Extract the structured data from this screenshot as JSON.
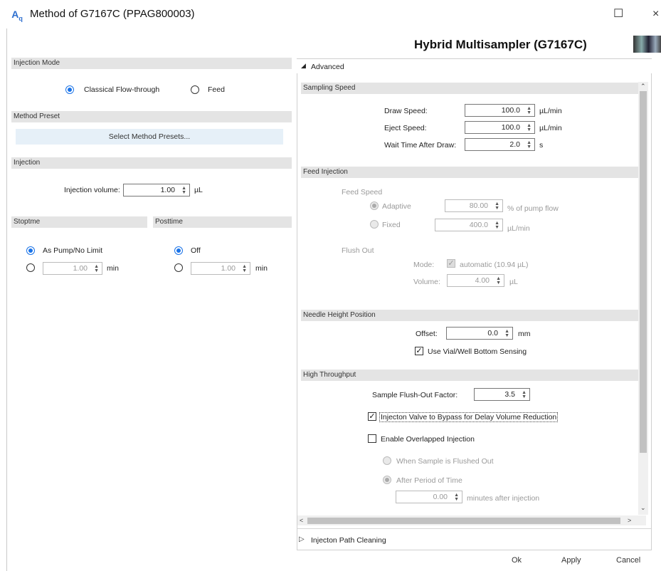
{
  "window": {
    "title": "Method of G7167C (PPAG800003)",
    "icon": "agilent-method-icon",
    "maximize_glyph": "☐",
    "close_glyph": "×",
    "device_title": "Hybrid Multisampler (G7167C)"
  },
  "left": {
    "injection_mode": {
      "header": "Injection Mode",
      "options": [
        "Classical Flow-through",
        "Feed"
      ],
      "selected": "Classical Flow-through"
    },
    "method_preset": {
      "header": "Method Preset",
      "button": "Select Method Presets..."
    },
    "injection": {
      "header": "Injection",
      "volume_label": "Injection volume:",
      "volume_value": "1.00",
      "volume_unit": "µL"
    },
    "stoptime": {
      "header": "Stoptme",
      "option_limit": "As Pump/No Limit",
      "value": "1.00",
      "unit": "min"
    },
    "posttime": {
      "header": "Posttime",
      "option_off": "Off",
      "value": "1.00",
      "unit": "min"
    }
  },
  "advanced": {
    "header": "Advanced",
    "sampling_speed": {
      "header": "Sampling Speed",
      "draw_label": "Draw Speed:",
      "draw_value": "100.0",
      "draw_unit": "µL/min",
      "eject_label": "Eject Speed:",
      "eject_value": "100.0",
      "eject_unit": "µL/min",
      "wait_label": "Wait Time After Draw:",
      "wait_value": "2.0",
      "wait_unit": "s"
    },
    "feed_injection": {
      "header": "Feed Injection",
      "feed_speed_label": "Feed Speed",
      "adaptive_label": "Adaptive",
      "adaptive_value": "80.00",
      "adaptive_unit": "% of pump flow",
      "fixed_label": "Fixed",
      "fixed_value": "400.0",
      "fixed_unit": "µL/min",
      "flush_out_label": "Flush Out",
      "mode_label": "Mode:",
      "mode_value": "automatic (10.94 µL)",
      "volume_label": "Volume:",
      "volume_value": "4.00",
      "volume_unit": "µL"
    },
    "needle_height": {
      "header": "Needle Height Position",
      "offset_label": "Offset:",
      "offset_value": "0.0",
      "offset_unit": "mm",
      "sensing_label": "Use Vial/Well Bottom Sensing"
    },
    "high_throughput": {
      "header": "High Throughput",
      "flush_factor_label": "Sample Flush-Out Factor:",
      "flush_factor_value": "3.5",
      "bypass_label": "Injecton Valve to Bypass for Delay Volume Reduction",
      "overlapped_label": "Enable Overlapped Injection",
      "when_flushed_label": "When Sample is Flushed Out",
      "after_period_label": "After Period of Time",
      "period_value": "0.00",
      "period_unit": "minutes after injection"
    },
    "path_cleaning": "Injecton Path Cleaning"
  },
  "buttons": {
    "ok": "Ok",
    "apply": "Apply",
    "cancel": "Cancel"
  }
}
